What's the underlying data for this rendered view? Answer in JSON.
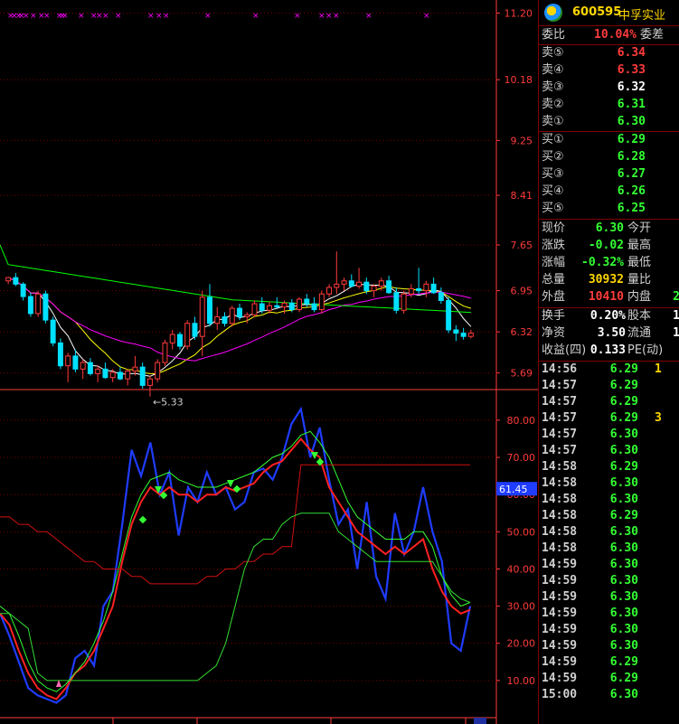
{
  "stock": {
    "code": "600595",
    "name": "中孚实业"
  },
  "colors": {
    "up": "#ff3b3b",
    "down": "#00e0ff",
    "green": "#33ff33",
    "grid": "#7a0000",
    "axis": "#ff3b3b",
    "ma5": "#ffffff",
    "ma10": "#ffff00",
    "ma20": "#ff00ff",
    "ma60": "#00ff00"
  },
  "order_ratio": {
    "label1": "委比",
    "value": "10.04%",
    "label2": "委差"
  },
  "asks": [
    {
      "label": "卖⑤",
      "price": "6.34",
      "color": "#ff3b3b"
    },
    {
      "label": "卖④",
      "price": "6.33",
      "color": "#ff3b3b"
    },
    {
      "label": "卖③",
      "price": "6.32",
      "color": "#ffffff"
    },
    {
      "label": "卖②",
      "price": "6.31",
      "color": "#33ff33"
    },
    {
      "label": "卖①",
      "price": "6.30",
      "color": "#33ff33"
    }
  ],
  "bids": [
    {
      "label": "买①",
      "price": "6.29",
      "color": "#33ff33"
    },
    {
      "label": "买②",
      "price": "6.28",
      "color": "#33ff33"
    },
    {
      "label": "买③",
      "price": "6.27",
      "color": "#33ff33"
    },
    {
      "label": "买④",
      "price": "6.26",
      "color": "#33ff33"
    },
    {
      "label": "买⑤",
      "price": "6.25",
      "color": "#33ff33"
    }
  ],
  "quote": [
    {
      "label": "现价",
      "value": "6.30",
      "color": "#33ff33",
      "label2": "今开"
    },
    {
      "label": "涨跌",
      "value": "-0.02",
      "color": "#33ff33",
      "label2": "最高"
    },
    {
      "label": "涨幅",
      "value": "-0.32%",
      "color": "#33ff33",
      "label2": "最低"
    },
    {
      "label": "总量",
      "value": "30932",
      "color": "#ffd700",
      "label2": "量比"
    },
    {
      "label": "外盘",
      "value": "10410",
      "color": "#ff3b3b",
      "label2": "内盘",
      "extra": "2",
      "extra_color": "#33ff33"
    }
  ],
  "fundamentals": [
    {
      "label": "换手",
      "value": "0.20%",
      "label2": "股本",
      "extra": "1"
    },
    {
      "label": "净资",
      "value": "3.50",
      "label2": "流通",
      "extra": "1"
    },
    {
      "label": "收益(四)",
      "value": "0.133",
      "label2": "PE(动)",
      "extra": ""
    }
  ],
  "ticks": [
    {
      "time": "14:56",
      "price": "6.29",
      "vol": "1"
    },
    {
      "time": "14:57",
      "price": "6.29",
      "vol": ""
    },
    {
      "time": "14:57",
      "price": "6.29",
      "vol": ""
    },
    {
      "time": "14:57",
      "price": "6.29",
      "vol": "3"
    },
    {
      "time": "14:57",
      "price": "6.30",
      "vol": ""
    },
    {
      "time": "14:57",
      "price": "6.30",
      "vol": ""
    },
    {
      "time": "14:58",
      "price": "6.29",
      "vol": ""
    },
    {
      "time": "14:58",
      "price": "6.30",
      "vol": ""
    },
    {
      "time": "14:58",
      "price": "6.30",
      "vol": ""
    },
    {
      "time": "14:58",
      "price": "6.29",
      "vol": ""
    },
    {
      "time": "14:58",
      "price": "6.30",
      "vol": ""
    },
    {
      "time": "14:58",
      "price": "6.30",
      "vol": ""
    },
    {
      "time": "14:59",
      "price": "6.30",
      "vol": ""
    },
    {
      "time": "14:59",
      "price": "6.30",
      "vol": ""
    },
    {
      "time": "14:59",
      "price": "6.30",
      "vol": ""
    },
    {
      "time": "14:59",
      "price": "6.30",
      "vol": ""
    },
    {
      "time": "14:59",
      "price": "6.30",
      "vol": ""
    },
    {
      "time": "14:59",
      "price": "6.30",
      "vol": ""
    },
    {
      "time": "14:59",
      "price": "6.29",
      "vol": ""
    },
    {
      "time": "14:59",
      "price": "6.29",
      "vol": ""
    },
    {
      "time": "15:00",
      "price": "6.30",
      "vol": ""
    }
  ],
  "chart_data": [
    {
      "type": "candlestick",
      "y_ticks": [
        "11.20",
        "10.18",
        "9.25",
        "8.41",
        "7.65",
        "6.95",
        "6.32",
        "5.69"
      ],
      "ylim": [
        5.45,
        11.4
      ],
      "annotation": "←5.33",
      "candles": [
        [
          7.1,
          7.16,
          7.05,
          7.15
        ],
        [
          7.15,
          7.22,
          7.02,
          7.05
        ],
        [
          7.05,
          7.08,
          6.8,
          6.86
        ],
        [
          6.86,
          6.92,
          6.55,
          6.6
        ],
        [
          6.6,
          6.95,
          6.55,
          6.9
        ],
        [
          6.9,
          6.95,
          6.45,
          6.5
        ],
        [
          6.5,
          6.55,
          6.1,
          6.15
        ],
        [
          6.15,
          6.22,
          5.75,
          5.8
        ],
        [
          5.8,
          6.0,
          5.55,
          5.95
        ],
        [
          5.95,
          6.05,
          5.7,
          5.75
        ],
        [
          5.75,
          5.9,
          5.6,
          5.85
        ],
        [
          5.85,
          5.92,
          5.65,
          5.68
        ],
        [
          5.68,
          5.8,
          5.55,
          5.75
        ],
        [
          5.75,
          5.85,
          5.6,
          5.62
        ],
        [
          5.62,
          5.75,
          5.55,
          5.7
        ],
        [
          5.7,
          5.78,
          5.58,
          5.6
        ],
        [
          5.6,
          5.75,
          5.5,
          5.72
        ],
        [
          5.72,
          5.95,
          5.65,
          5.78
        ],
        [
          5.78,
          5.85,
          5.45,
          5.5
        ],
        [
          5.5,
          5.65,
          5.33,
          5.6
        ],
        [
          5.6,
          5.9,
          5.55,
          5.85
        ],
        [
          5.85,
          6.2,
          5.8,
          6.15
        ],
        [
          6.15,
          6.35,
          6.05,
          6.28
        ],
        [
          6.28,
          6.32,
          6.05,
          6.1
        ],
        [
          6.1,
          6.5,
          6.05,
          6.45
        ],
        [
          6.45,
          6.55,
          6.2,
          6.25
        ],
        [
          6.25,
          6.95,
          5.95,
          6.85
        ],
        [
          6.85,
          7.05,
          6.4,
          6.45
        ],
        [
          6.45,
          6.7,
          6.35,
          6.55
        ],
        [
          6.55,
          6.62,
          6.4,
          6.45
        ],
        [
          6.45,
          6.72,
          6.4,
          6.68
        ],
        [
          6.68,
          6.75,
          6.5,
          6.55
        ],
        [
          6.55,
          6.62,
          6.45,
          6.58
        ],
        [
          6.58,
          6.8,
          6.55,
          6.75
        ],
        [
          6.75,
          6.85,
          6.6,
          6.65
        ],
        [
          6.65,
          6.78,
          6.6,
          6.72
        ],
        [
          6.72,
          6.85,
          6.68,
          6.7
        ],
        [
          6.7,
          6.8,
          6.6,
          6.76
        ],
        [
          6.76,
          6.82,
          6.62,
          6.66
        ],
        [
          6.66,
          6.85,
          6.62,
          6.82
        ],
        [
          6.82,
          6.9,
          6.7,
          6.75
        ],
        [
          6.75,
          6.85,
          6.62,
          6.66
        ],
        [
          6.66,
          6.95,
          6.6,
          6.9
        ],
        [
          6.9,
          7.05,
          6.85,
          7.0
        ],
        [
          7.0,
          7.55,
          6.9,
          7.05
        ],
        [
          7.05,
          7.15,
          6.95,
          7.1
        ],
        [
          7.1,
          7.2,
          7.0,
          7.02
        ],
        [
          7.02,
          7.3,
          6.98,
          7.08
        ],
        [
          7.08,
          7.15,
          6.9,
          6.95
        ],
        [
          6.95,
          7.05,
          6.85,
          7.02
        ],
        [
          7.02,
          7.15,
          6.95,
          7.1
        ],
        [
          7.1,
          7.18,
          6.9,
          6.92
        ],
        [
          6.92,
          7.0,
          6.6,
          6.65
        ],
        [
          6.65,
          6.95,
          6.6,
          6.9
        ],
        [
          6.9,
          7.05,
          6.85,
          6.98
        ],
        [
          6.98,
          7.3,
          6.9,
          6.95
        ],
        [
          6.95,
          7.1,
          6.85,
          7.05
        ],
        [
          7.05,
          7.15,
          6.9,
          6.92
        ],
        [
          6.92,
          7.0,
          6.75,
          6.8
        ],
        [
          6.8,
          6.85,
          6.3,
          6.35
        ],
        [
          6.35,
          6.42,
          6.18,
          6.3
        ],
        [
          6.3,
          6.38,
          6.2,
          6.25
        ],
        [
          6.25,
          6.35,
          6.22,
          6.3
        ]
      ]
    },
    {
      "type": "line",
      "y_ticks": [
        "80.00",
        "70.00",
        "60.00",
        "50.00",
        "40.00",
        "30.00",
        "20.00",
        "10.00"
      ],
      "ylim": [
        0,
        88
      ],
      "current_value_label": "61.45",
      "series": [
        {
          "values": [
            28,
            22,
            15,
            8,
            6,
            5,
            4,
            6,
            16,
            18,
            14,
            30,
            34,
            52,
            72,
            65,
            74,
            60,
            66,
            49,
            62,
            58,
            66,
            60,
            62,
            56,
            58,
            66,
            67,
            64,
            70,
            79,
            83,
            70,
            78,
            64,
            52,
            56,
            40,
            58,
            38,
            32,
            55,
            44,
            50,
            62,
            50,
            42,
            20,
            18,
            30
          ]
        },
        {
          "values": [
            28,
            25,
            18,
            12,
            8,
            6,
            5,
            8,
            12,
            14,
            18,
            24,
            30,
            42,
            52,
            58,
            62,
            60,
            62,
            60,
            60,
            58,
            60,
            60,
            62,
            61,
            62,
            63,
            66,
            68,
            69,
            72,
            75,
            72,
            70,
            62,
            58,
            54,
            50,
            48,
            46,
            44,
            46,
            44,
            46,
            48,
            40,
            34,
            30,
            28,
            29
          ]
        },
        {
          "values": [
            30,
            28,
            22,
            15,
            10,
            8,
            7,
            9,
            12,
            15,
            20,
            26,
            34,
            44,
            54,
            60,
            64,
            65,
            66,
            64,
            63,
            62,
            62,
            62,
            63,
            64,
            65,
            66,
            68,
            70,
            71,
            73,
            76,
            77,
            74,
            70,
            64,
            58,
            54,
            52,
            50,
            48,
            48,
            48,
            50,
            50,
            46,
            38,
            33,
            30,
            31
          ]
        },
        {
          "values": [
            54,
            54,
            52,
            52,
            50,
            50,
            48,
            46,
            44,
            42,
            42,
            40,
            40,
            40,
            38,
            38,
            36,
            36,
            36,
            36,
            36,
            36,
            38,
            38,
            40,
            40,
            42,
            42,
            44,
            44,
            46,
            46,
            68,
            68,
            68,
            68,
            68,
            68,
            68,
            68,
            68,
            68,
            68,
            68,
            68,
            68,
            68,
            68,
            68,
            68,
            68
          ]
        },
        {
          "values": [
            28,
            28,
            26,
            24,
            12,
            10,
            10,
            10,
            10,
            10,
            10,
            10,
            10,
            10,
            10,
            10,
            10,
            10,
            10,
            10,
            10,
            10,
            12,
            14,
            20,
            30,
            40,
            46,
            48,
            48,
            52,
            54,
            55,
            55,
            55,
            55,
            50,
            48,
            46,
            44,
            42,
            42,
            42,
            42,
            42,
            42,
            42,
            38,
            34,
            32,
            31
          ]
        }
      ]
    }
  ]
}
